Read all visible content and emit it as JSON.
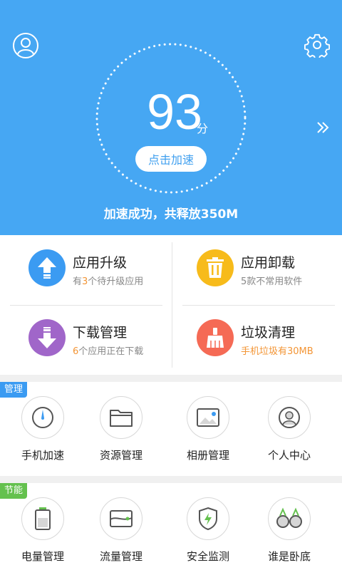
{
  "header": {
    "score": "93",
    "score_unit": "分",
    "boost_label": "点击加速",
    "result_text": "加速成功，共释放350M",
    "avatar_icon": "user-avatar-icon",
    "settings_icon": "gear-icon",
    "more_icon": "double-chevron-right-icon",
    "bg_color": "#46a7f3"
  },
  "features": [
    {
      "title": "应用升级",
      "sub_pre": "有",
      "sub_hl": "3",
      "sub_post": "个待升级应用",
      "icon": "upload-arrow-icon",
      "color": "#3b9bf2"
    },
    {
      "title": "应用卸载",
      "sub": "5款不常用软件",
      "icon": "trash-icon",
      "color": "#f7bb1b"
    },
    {
      "title": "下载管理",
      "sub_hl": "6",
      "sub_post": "个应用正在下载",
      "icon": "download-arrow-icon",
      "color": "#a066c9"
    },
    {
      "title": "垃圾清理",
      "sub": "手机垃圾有30MB",
      "icon": "broom-icon",
      "color": "#f56a55"
    }
  ],
  "sections": [
    {
      "tag": "管理",
      "tag_color": "#3b9bf2",
      "tools": [
        {
          "label": "手机加速",
          "icon": "speedometer-icon"
        },
        {
          "label": "资源管理",
          "icon": "folder-icon"
        },
        {
          "label": "相册管理",
          "icon": "photo-album-icon"
        },
        {
          "label": "个人中心",
          "icon": "user-center-icon"
        }
      ]
    },
    {
      "tag": "节能",
      "tag_color": "#64c14e",
      "tools": [
        {
          "label": "电量管理",
          "icon": "battery-icon"
        },
        {
          "label": "流量管理",
          "icon": "data-traffic-icon"
        },
        {
          "label": "安全监测",
          "icon": "shield-icon"
        },
        {
          "label": "谁是卧底",
          "icon": "undercover-icon"
        }
      ]
    }
  ]
}
